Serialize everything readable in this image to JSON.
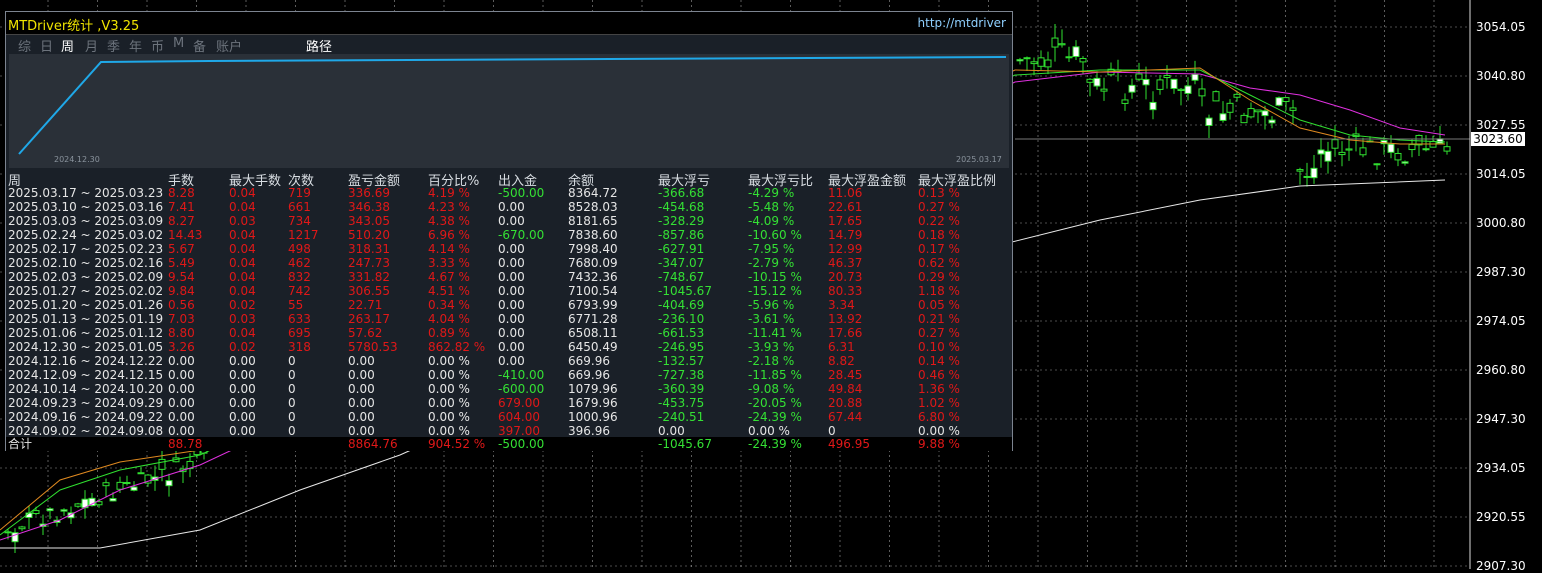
{
  "price_axis": {
    "labels": [
      "3054.05",
      "3040.80",
      "3027.55",
      "3014.05",
      "3000.80",
      "2987.30",
      "2974.05",
      "2960.80",
      "2947.30",
      "2934.05",
      "2920.55",
      "2907.30"
    ],
    "current_price": "3023.60"
  },
  "panel": {
    "title": "MTDriver统计 ,V3.25",
    "url": "http://mtdriver",
    "tabs": [
      "综",
      "日",
      "周",
      "月",
      "季",
      "年",
      "币",
      "M",
      "备",
      "账户",
      "路径"
    ],
    "active_tab": "周",
    "equity": {
      "start_date": "2024.12.30",
      "end_date": "2025.03.17"
    },
    "columns": [
      "周",
      "手数",
      "最大手数",
      "次数",
      "盈亏金额",
      "百分比%",
      "出入金",
      "余额",
      "最大浮亏",
      "最大浮亏比",
      "最大浮盈金额",
      "最大浮盈比例"
    ],
    "rows": [
      [
        "2025.03.17 ~ 2025.03.23",
        "8.28",
        "0.04",
        "719",
        "336.69",
        "4.19 %",
        "-500.00",
        "8364.72",
        "-366.68",
        "-4.29 %",
        "11.06",
        "0.13 %"
      ],
      [
        "2025.03.10 ~ 2025.03.16",
        "7.41",
        "0.04",
        "661",
        "346.38",
        "4.23 %",
        "0.00",
        "8528.03",
        "-454.68",
        "-5.48 %",
        "22.61",
        "0.27 %"
      ],
      [
        "2025.03.03 ~ 2025.03.09",
        "8.27",
        "0.03",
        "734",
        "343.05",
        "4.38 %",
        "0.00",
        "8181.65",
        "-328.29",
        "-4.09 %",
        "17.65",
        "0.22 %"
      ],
      [
        "2025.02.24 ~ 2025.03.02",
        "14.43",
        "0.04",
        "1217",
        "510.20",
        "6.96 %",
        "-670.00",
        "7838.60",
        "-857.86",
        "-10.60 %",
        "14.79",
        "0.18 %"
      ],
      [
        "2025.02.17 ~ 2025.02.23",
        "5.67",
        "0.04",
        "498",
        "318.31",
        "4.14 %",
        "0.00",
        "7998.40",
        "-627.91",
        "-7.95 %",
        "12.99",
        "0.17 %"
      ],
      [
        "2025.02.10 ~ 2025.02.16",
        "5.49",
        "0.04",
        "462",
        "247.73",
        "3.33 %",
        "0.00",
        "7680.09",
        "-347.07",
        "-2.79 %",
        "46.37",
        "0.62 %"
      ],
      [
        "2025.02.03 ~ 2025.02.09",
        "9.54",
        "0.04",
        "832",
        "331.82",
        "4.67 %",
        "0.00",
        "7432.36",
        "-748.67",
        "-10.15 %",
        "20.73",
        "0.29 %"
      ],
      [
        "2025.01.27 ~ 2025.02.02",
        "9.84",
        "0.04",
        "742",
        "306.55",
        "4.51 %",
        "0.00",
        "7100.54",
        "-1045.67",
        "-15.12 %",
        "80.33",
        "1.18 %"
      ],
      [
        "2025.01.20 ~ 2025.01.26",
        "0.56",
        "0.02",
        "55",
        "22.71",
        "0.34 %",
        "0.00",
        "6793.99",
        "-404.69",
        "-5.96 %",
        "3.34",
        "0.05 %"
      ],
      [
        "2025.01.13 ~ 2025.01.19",
        "7.03",
        "0.03",
        "633",
        "263.17",
        "4.04 %",
        "0.00",
        "6771.28",
        "-236.10",
        "-3.61 %",
        "13.92",
        "0.21 %"
      ],
      [
        "2025.01.06 ~ 2025.01.12",
        "8.80",
        "0.04",
        "695",
        "57.62",
        "0.89 %",
        "0.00",
        "6508.11",
        "-661.53",
        "-11.41 %",
        "17.66",
        "0.27 %"
      ],
      [
        "2024.12.30 ~ 2025.01.05",
        "3.26",
        "0.02",
        "318",
        "5780.53",
        "862.82 %",
        "0.00",
        "6450.49",
        "-246.95",
        "-3.93 %",
        "6.31",
        "0.10 %"
      ],
      [
        "2024.12.16 ~ 2024.12.22",
        "0.00",
        "0.00",
        "0",
        "0.00",
        "0.00 %",
        "0.00",
        "669.96",
        "-132.57",
        "-2.18 %",
        "8.82",
        "0.14 %"
      ],
      [
        "2024.12.09 ~ 2024.12.15",
        "0.00",
        "0.00",
        "0",
        "0.00",
        "0.00 %",
        "-410.00",
        "669.96",
        "-727.38",
        "-11.85 %",
        "28.45",
        "0.46 %"
      ],
      [
        "2024.10.14 ~ 2024.10.20",
        "0.00",
        "0.00",
        "0",
        "0.00",
        "0.00 %",
        "-600.00",
        "1079.96",
        "-360.39",
        "-9.08 %",
        "49.84",
        "1.36 %"
      ],
      [
        "2024.09.23 ~ 2024.09.29",
        "0.00",
        "0.00",
        "0",
        "0.00",
        "0.00 %",
        "679.00",
        "1679.96",
        "-453.75",
        "-20.05 %",
        "20.88",
        "1.02 %"
      ],
      [
        "2024.09.16 ~ 2024.09.22",
        "0.00",
        "0.00",
        "0",
        "0.00",
        "0.00 %",
        "604.00",
        "1000.96",
        "-240.51",
        "-24.39 %",
        "67.44",
        "6.80 %"
      ],
      [
        "2024.09.02 ~ 2024.09.08",
        "0.00",
        "0.00",
        "0",
        "0.00",
        "0.00 %",
        "397.00",
        "396.96",
        "0.00",
        "0.00 %",
        "0",
        "0.00 %"
      ]
    ],
    "total": [
      "合计",
      "88.78",
      "",
      "",
      "8864.76",
      "904.52 %",
      "-500.00",
      "",
      "-1045.67",
      "-24.39 %",
      "496.95",
      "9.88 %"
    ]
  },
  "colors": {
    "title": "#f0e500",
    "positive": "#e01818",
    "negative": "#34e034",
    "neutral": "#e6e6e6",
    "equity_line": "#1fa8e8"
  }
}
